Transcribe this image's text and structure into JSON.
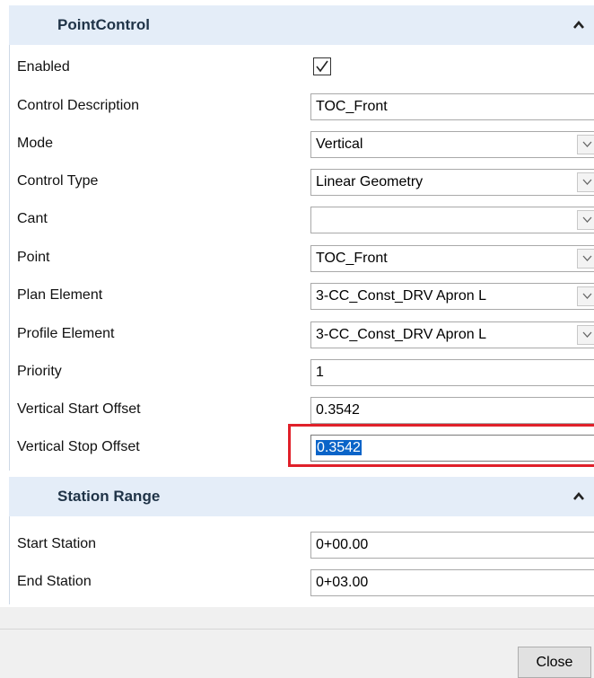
{
  "point_control": {
    "title": "PointControl",
    "rows": [
      {
        "label": "Enabled",
        "checked": true
      },
      {
        "label": "Control Description",
        "value": "TOC_Front"
      },
      {
        "label": "Mode",
        "value": "Vertical"
      },
      {
        "label": "Control Type",
        "value": "Linear Geometry"
      },
      {
        "label": "Cant",
        "value": ""
      },
      {
        "label": "Point",
        "value": "TOC_Front"
      },
      {
        "label": "Plan Element",
        "value": "3-CC_Const_DRV Apron L"
      },
      {
        "label": "Profile Element",
        "value": "3-CC_Const_DRV Apron L"
      },
      {
        "label": "Priority",
        "value": "1"
      },
      {
        "label": "Vertical Start Offset",
        "value": "0.3542"
      },
      {
        "label": "Vertical Stop Offset",
        "value": "0.3542"
      }
    ]
  },
  "station_range": {
    "title": "Station Range",
    "rows": [
      {
        "label": "Start Station",
        "value": "0+00.00"
      },
      {
        "label": "End Station",
        "value": "0+03.00"
      }
    ]
  },
  "footer": {
    "close_label": "Close"
  },
  "colors": {
    "header_bg": "#e4edf8",
    "selection": "#0a64c8",
    "highlight": "#e0202a"
  },
  "icons": {
    "collapse": "chevron-up-icon",
    "dropdown": "chevron-down-icon",
    "check": "checkmark-icon"
  }
}
